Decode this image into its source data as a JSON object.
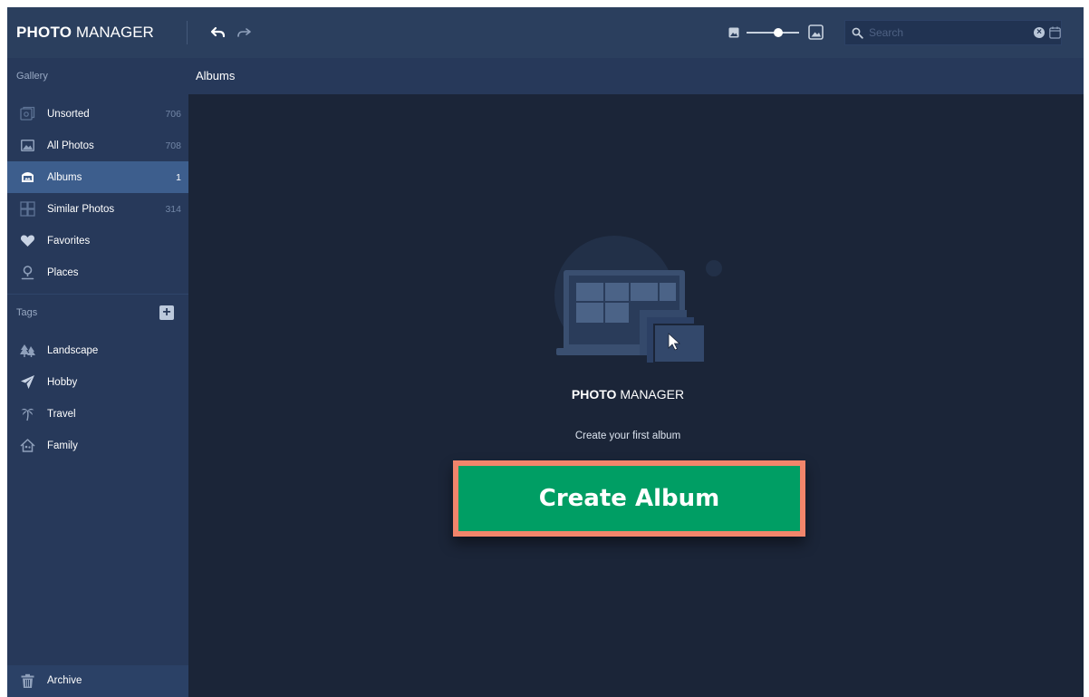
{
  "app": {
    "brand_bold": "PHOTO",
    "brand_light": "MANAGER"
  },
  "toolbar": {
    "undo_icon": "undo-icon",
    "redo_icon": "redo-icon",
    "zoom_level": 0.6,
    "search_placeholder": "Search"
  },
  "sidebar": {
    "gallery_heading": "Gallery",
    "gallery_items": [
      {
        "label": "Unsorted",
        "count": "706",
        "icon": "unsorted-icon"
      },
      {
        "label": "All Photos",
        "count": "708",
        "icon": "photos-icon"
      },
      {
        "label": "Albums",
        "count": "1",
        "icon": "albums-icon",
        "active": true
      },
      {
        "label": "Similar Photos",
        "count": "314",
        "icon": "similar-icon"
      },
      {
        "label": "Favorites",
        "count": "",
        "icon": "heart-icon"
      },
      {
        "label": "Places",
        "count": "",
        "icon": "pin-icon"
      }
    ],
    "tags_heading": "Tags",
    "tag_items": [
      {
        "label": "Landscape",
        "icon": "trees-icon"
      },
      {
        "label": "Hobby",
        "icon": "plane-icon"
      },
      {
        "label": "Travel",
        "icon": "palm-icon"
      },
      {
        "label": "Family",
        "icon": "family-icon"
      }
    ],
    "archive_label": "Archive"
  },
  "main": {
    "header_title": "Albums",
    "empty_brand_bold": "PHOTO",
    "empty_brand_light": "MANAGER",
    "empty_message": "Create your first album",
    "create_button_label": "Create Album"
  },
  "colors": {
    "app_background": "#1b2538",
    "toolbar": "#2b3f5e",
    "sidebar": "#27395a",
    "active_item": "#3d5e8d",
    "create_button": "#009e64",
    "create_button_highlight": "#f2856b"
  }
}
